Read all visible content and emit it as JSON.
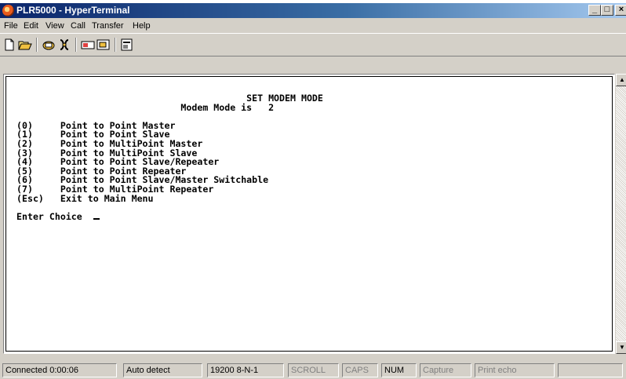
{
  "window": {
    "title": "PLR5000 - HyperTerminal"
  },
  "menu": [
    "File",
    "Edit",
    "View",
    "Call",
    "Transfer",
    "Help"
  ],
  "toolbar": {
    "icons": [
      "new-document-icon",
      "open-folder-icon",
      "connect-phone-icon",
      "disconnect-phone-icon",
      "send-icon",
      "receive-icon",
      "properties-icon"
    ]
  },
  "terminal": {
    "title": "SET MODEM MODE",
    "mode_line": "Modem Mode is   2",
    "options": [
      {
        "key": "(0)",
        "label": "Point to Point Master"
      },
      {
        "key": "(1)",
        "label": "Point to Point Slave"
      },
      {
        "key": "(2)",
        "label": "Point to MultiPoint Master"
      },
      {
        "key": "(3)",
        "label": "Point to MultiPoint Slave"
      },
      {
        "key": "(4)",
        "label": "Point to Point Slave/Repeater"
      },
      {
        "key": "(5)",
        "label": "Point to Point Repeater"
      },
      {
        "key": "(6)",
        "label": "Point to Point Slave/Master Switchable"
      },
      {
        "key": "(7)",
        "label": "Point to MultiPoint Repeater"
      },
      {
        "key": "(Esc)",
        "label": "Exit to Main Menu"
      }
    ],
    "prompt": "Enter Choice"
  },
  "status": {
    "connected": "Connected 0:00:06",
    "detect": "Auto detect",
    "port_settings": "19200 8-N-1",
    "scroll": "SCROLL",
    "caps": "CAPS",
    "num": "NUM",
    "capture": "Capture",
    "print_echo": "Print echo"
  },
  "colors": {
    "title_bar_start": "#0a246a",
    "title_bar_end": "#a6caf0",
    "chrome": "#d4d0c8",
    "terminal_bg": "#ffffff",
    "terminal_fg": "#000000"
  }
}
